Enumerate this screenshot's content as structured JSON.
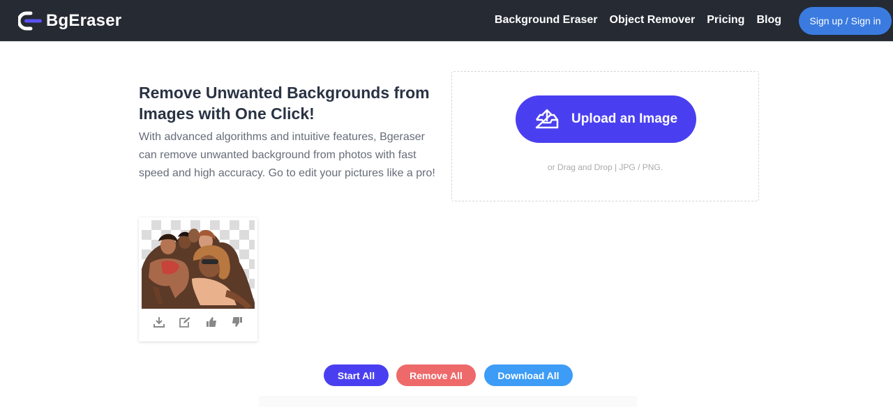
{
  "header": {
    "logo_text": "BgEraser",
    "nav": [
      {
        "label": "Background Eraser"
      },
      {
        "label": "Object Remover"
      },
      {
        "label": "Pricing"
      },
      {
        "label": "Blog"
      }
    ],
    "signin_label": "Sign up / Sign in"
  },
  "hero": {
    "title": "Remove Unwanted Backgrounds from Images with One Click!",
    "description": "With advanced algorithms and intuitive features, Bgeraser can remove unwanted background from photos with fast speed and high accuracy. Go to edit your pictures like a pro!"
  },
  "upload": {
    "button_label": "Upload an Image",
    "hint": "or Drag and Drop | JPG / PNG."
  },
  "result_card": {
    "icons": [
      "download-icon",
      "edit-icon",
      "thumbs-up-icon",
      "thumbs-down-icon"
    ]
  },
  "bulk_actions": {
    "start_label": "Start All",
    "remove_label": "Remove All",
    "download_label": "Download All"
  },
  "colors": {
    "header_bg": "#252a33",
    "accent": "#4a3ff0",
    "signin": "#3b7be0",
    "remove": "#ee6a6a",
    "download": "#3d9cf5"
  }
}
